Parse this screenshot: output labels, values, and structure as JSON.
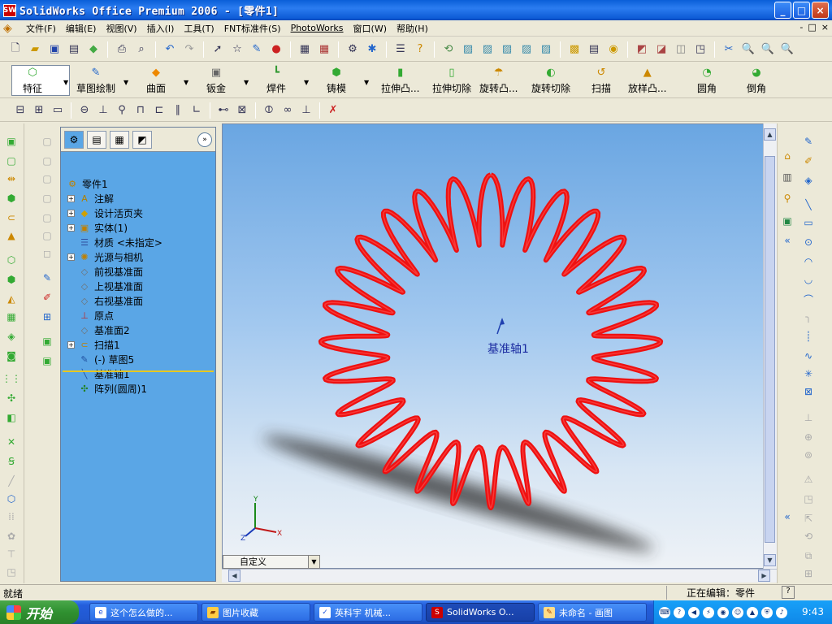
{
  "window": {
    "title": "SolidWorks Office Premium 2006 - [零件1]",
    "app_icon_text": "SW",
    "minimize": "_",
    "maximize": "□",
    "close": "×"
  },
  "menu": {
    "items": [
      "文件(F)",
      "编辑(E)",
      "视图(V)",
      "插入(I)",
      "工具(T)",
      "FNT标准件(S)",
      "PhotoWorks",
      "窗口(W)",
      "帮助(H)"
    ],
    "mdi_buttons": [
      "-",
      "□",
      "×"
    ]
  },
  "features_toolbar": {
    "buttons": [
      {
        "label": "特征",
        "icon": "feature-icon"
      },
      {
        "label": "草图绘制",
        "icon": "sketch-icon"
      },
      {
        "label": "曲面",
        "icon": "surface-icon"
      },
      {
        "label": "钣金",
        "icon": "sheetmetal-icon"
      },
      {
        "label": "焊件",
        "icon": "weldment-icon"
      },
      {
        "label": "铸模",
        "icon": "mold-icon"
      },
      {
        "label": "拉伸凸...",
        "icon": "extrude-boss-icon"
      },
      {
        "label": "拉伸切除",
        "icon": "extrude-cut-icon"
      },
      {
        "label": "旋转凸...",
        "icon": "revolve-boss-icon"
      },
      {
        "label": "旋转切除",
        "icon": "revolve-cut-icon"
      },
      {
        "label": "扫描",
        "icon": "sweep-icon"
      },
      {
        "label": "放样凸...",
        "icon": "loft-icon"
      },
      {
        "label": "圆角",
        "icon": "fillet-icon"
      },
      {
        "label": "倒角",
        "icon": "chamfer-icon"
      }
    ]
  },
  "feature_tree": {
    "root": "零件1",
    "items": [
      {
        "label": "注解",
        "expandable": true,
        "icon": "annotation-icon"
      },
      {
        "label": "设计活页夹",
        "expandable": true,
        "icon": "binder-icon"
      },
      {
        "label": "实体(1)",
        "expandable": true,
        "icon": "solid-body-icon"
      },
      {
        "label": "材质 <未指定>",
        "expandable": false,
        "icon": "material-icon"
      },
      {
        "label": "光源与相机",
        "expandable": true,
        "icon": "lights-icon"
      },
      {
        "label": "前视基准面",
        "expandable": false,
        "icon": "plane-icon"
      },
      {
        "label": "上视基准面",
        "expandable": false,
        "icon": "plane-icon"
      },
      {
        "label": "右视基准面",
        "expandable": false,
        "icon": "plane-icon"
      },
      {
        "label": "原点",
        "expandable": false,
        "icon": "origin-icon"
      },
      {
        "label": "基准面2",
        "expandable": false,
        "icon": "plane-icon"
      },
      {
        "label": "扫描1",
        "expandable": true,
        "icon": "sweep-icon"
      },
      {
        "label": "(-) 草图5",
        "expandable": false,
        "icon": "sketch-icon"
      },
      {
        "label": "基准轴1",
        "expandable": false,
        "icon": "axis-icon"
      },
      {
        "label": "阵列(圆周)1",
        "expandable": false,
        "icon": "circular-pattern-icon"
      }
    ]
  },
  "viewport": {
    "axis_label": "基准轴1",
    "view_orientation": "自定义",
    "triad": {
      "x": "X",
      "y": "Y",
      "z": "Z"
    },
    "model": {
      "type": "helical coil ring",
      "color": "#ee1111",
      "coil_count": 28
    }
  },
  "status": {
    "left": "就绪",
    "right": "正在编辑：零件",
    "help": "?"
  },
  "taskbar": {
    "start_label": "开始",
    "tasks": [
      {
        "label": "这个怎么做的...",
        "icon": "ie-icon"
      },
      {
        "label": "图片收藏",
        "icon": "folder-icon"
      },
      {
        "label": "英科宇 机械...",
        "icon": "app-icon"
      },
      {
        "label": "SolidWorks O...",
        "icon": "solidworks-icon",
        "active": true
      },
      {
        "label": "未命名 - 画图",
        "icon": "paint-icon"
      }
    ],
    "clock": "9:43"
  }
}
